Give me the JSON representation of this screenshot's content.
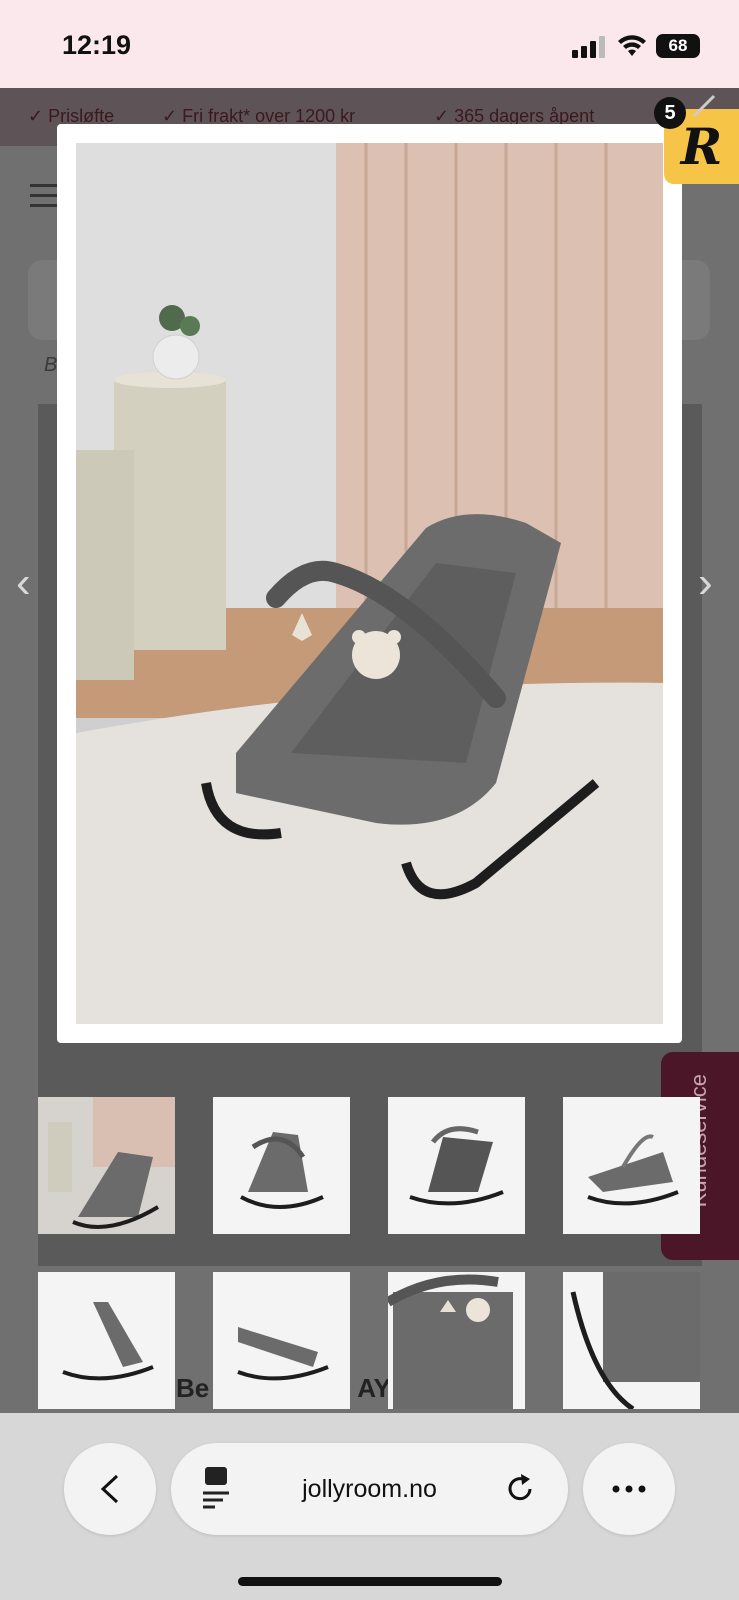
{
  "status_bar": {
    "time": "12:19",
    "battery": "68"
  },
  "page_behind": {
    "usps": [
      "✓ Prisløfte",
      "✓ Fri frakt* over 1200 kr",
      "✓ 365 dagers åpent"
    ],
    "breadcrumb_start": "B",
    "title_fragment_left": "Be",
    "title_fragment_right": "AY",
    "kundeservice_label": "Kundeservice",
    "notification_count": "5",
    "logo_letter": "R"
  },
  "gallery": {
    "main_image_alt": "Baby bouncer in grey with toy bar, bear and star",
    "thumbnail_count": 8
  },
  "browser": {
    "url": "jollyroom.no"
  },
  "icons": [
    "back-icon",
    "page-settings-icon",
    "reload-icon",
    "more-icon",
    "prev-arrow-icon",
    "next-arrow-icon",
    "close-icon"
  ],
  "colors": {
    "status_bg": "#fbe8ec",
    "kundeservice_bg": "#4a1628",
    "logo_bg": "#f6c548"
  }
}
